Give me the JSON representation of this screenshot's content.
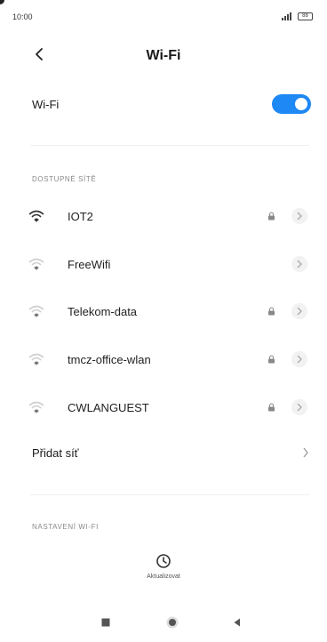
{
  "status_bar": {
    "time": "10:00",
    "battery": "88"
  },
  "header": {
    "title": "Wi-Fi"
  },
  "wifi_toggle": {
    "label": "Wi-Fi",
    "enabled": true
  },
  "available_networks": {
    "section_label": "DOSTUPNÉ SÍTĚ",
    "items": [
      {
        "name": "IOT2",
        "locked": true,
        "signal": "full"
      },
      {
        "name": "FreeWifi",
        "locked": false,
        "signal": "weak"
      },
      {
        "name": "Telekom-data",
        "locked": true,
        "signal": "weak"
      },
      {
        "name": "tmcz-office-wlan",
        "locked": true,
        "signal": "weak"
      },
      {
        "name": "CWLANGUEST",
        "locked": true,
        "signal": "weak"
      }
    ]
  },
  "add_network": {
    "label": "Přidat síť"
  },
  "settings_section": {
    "label": "NASTAVENÍ WI-FI"
  },
  "refresh": {
    "label": "Aktualizovat"
  },
  "colors": {
    "accent": "#1e88f5",
    "section_text": "#8a8a8a"
  }
}
